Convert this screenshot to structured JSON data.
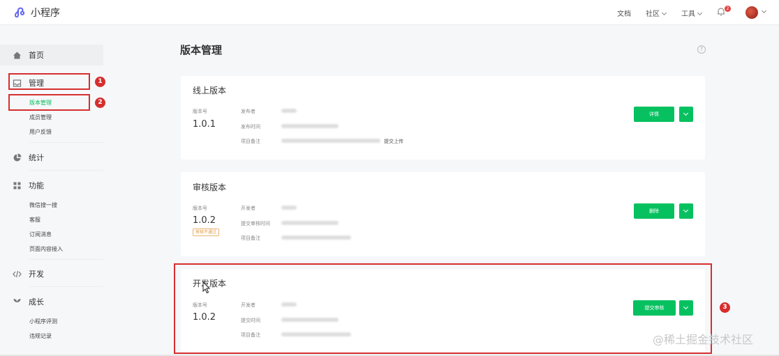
{
  "header": {
    "app_name": "小程序",
    "nav": {
      "docs": "文档",
      "community": "社区",
      "tools": "工具"
    },
    "notification_count": "2"
  },
  "sidebar": {
    "home": "首页",
    "manage": "管理",
    "manage_sub": [
      "版本管理",
      "成员管理",
      "用户反馈"
    ],
    "stats": "统计",
    "features": "功能",
    "features_sub": [
      "微信搜一搜",
      "客服",
      "订阅消息",
      "页面内容接入"
    ],
    "develop": "开发",
    "growth": "成长",
    "growth_sub": [
      "小程序评测",
      "违规记录"
    ]
  },
  "annotations": [
    "1",
    "2",
    "3"
  ],
  "page": {
    "title": "版本管理",
    "help": "?"
  },
  "online": {
    "title": "线上版本",
    "ver_label": "版本号",
    "version": "1.0.1",
    "labels": [
      "发布者",
      "发布时间",
      "项目备注"
    ],
    "note_suffix": "提交上传",
    "button": "详情"
  },
  "review": {
    "title": "审核版本",
    "ver_label": "版本号",
    "version": "1.0.2",
    "status": "审核不通过",
    "labels": [
      "开发者",
      "提交审核时间",
      "项目备注"
    ],
    "button": "删除"
  },
  "dev": {
    "title": "开发版本",
    "ver_label": "版本号",
    "version": "1.0.2",
    "labels": [
      "开发者",
      "提交时间",
      "项目备注"
    ],
    "button": "提交审核"
  },
  "watermark": "@稀土掘金技术社区",
  "colors": {
    "accent": "#07c160",
    "highlight": "#d62e2e",
    "warning": "#e49a3b"
  }
}
